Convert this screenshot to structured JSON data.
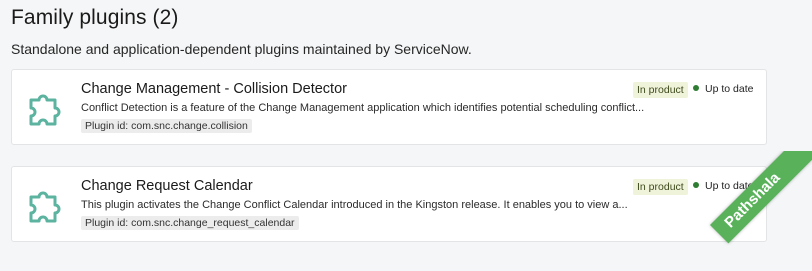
{
  "section": {
    "title": "Family plugins (2)",
    "subtitle": "Standalone and application-dependent plugins maintained by ServiceNow."
  },
  "plugins": [
    {
      "name": "Change Management - Collision Detector",
      "description": "Conflict Detection is a feature of the Change Management application which identifies potential scheduling conflict...",
      "plugin_id": "Plugin id: com.snc.change.collision",
      "badge": "In product",
      "status": "Up to date",
      "icon": "puzzle-icon"
    },
    {
      "name": "Change Request Calendar",
      "description": "This plugin activates the Change Conflict Calendar introduced in the Kingston release. It enables you to view a...",
      "plugin_id": "Plugin id: com.snc.change_request_calendar",
      "badge": "In product",
      "status": "Up to date",
      "icon": "puzzle-icon"
    }
  ],
  "ribbon": {
    "text": "Pathshala"
  },
  "colors": {
    "icon": "#5bb3a0",
    "status_dot": "#2e7d32",
    "badge_bg": "#eef3d9",
    "ribbon": "#59b25a"
  }
}
